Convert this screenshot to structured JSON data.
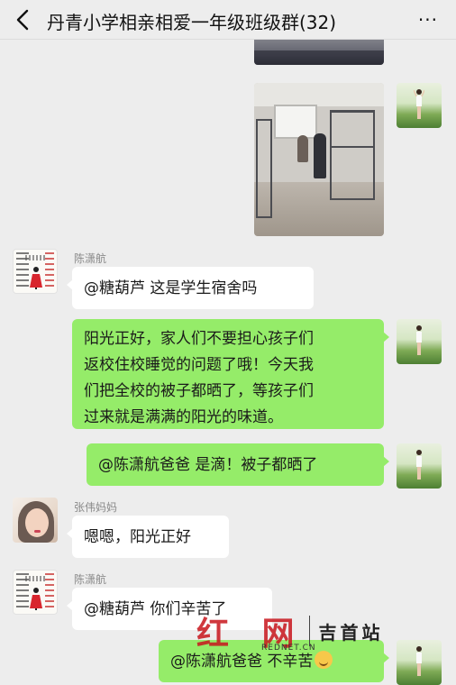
{
  "header": {
    "back_icon": "back-chevron-icon",
    "title": "丹青小学相亲相爱一年级班级群(32)",
    "more_icon": "more-dots-icon",
    "more_label": "···"
  },
  "messages": [
    {
      "type": "image",
      "side": "right",
      "description_icon": "photo-thumbnail"
    },
    {
      "type": "image",
      "side": "right",
      "description_icon": "dormitory-photo"
    },
    {
      "type": "text",
      "side": "left",
      "sender": "陈潇航",
      "text": "@糖葫芦  这是学生宿舍吗"
    },
    {
      "type": "text",
      "side": "right",
      "lines": [
        "阳光正好，家人们不要担心孩子们",
        "返校住校睡觉的问题了哦！今天我",
        "们把全校的被子都晒了，等孩子们",
        "过来就是满满的阳光的味道。"
      ]
    },
    {
      "type": "text",
      "side": "right",
      "text": "@陈潇航爸爸  是滴！被子都晒了"
    },
    {
      "type": "text",
      "side": "left",
      "sender": "张伟妈妈",
      "text": "嗯嗯，阳光正好"
    },
    {
      "type": "text",
      "side": "left",
      "sender": "陈潇航",
      "text": "@糖葫芦  你们辛苦了"
    },
    {
      "type": "text",
      "side": "right",
      "text": "@陈潇航爸爸  不辛苦",
      "emoji": "smile-emoji"
    }
  ],
  "watermark": {
    "brand": "红 网",
    "city": "吉首站",
    "url": "REDNET.CN"
  },
  "colors": {
    "background": "#ededed",
    "bubble_green": "#95ec69",
    "bubble_white": "#ffffff"
  }
}
